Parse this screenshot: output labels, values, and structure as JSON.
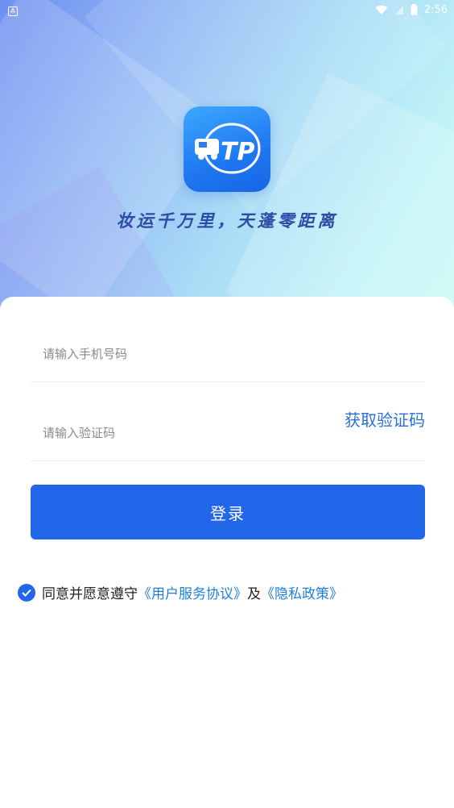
{
  "status_bar": {
    "app_badge": "A",
    "time": "2:56"
  },
  "logo": {
    "monogram": "TP"
  },
  "slogan": "妆运千万里，天蓬零距离",
  "form": {
    "phone_placeholder": "请输入手机号码",
    "code_placeholder": "请输入验证码",
    "get_code_label": "获取验证码",
    "login_label": "登录"
  },
  "agreement": {
    "checked": true,
    "prefix": "同意并愿意遵守",
    "user_agreement": "《用户服务协议》",
    "conjunction": "及",
    "privacy_policy": "《隐私政策》"
  },
  "colors": {
    "primary": "#2266ea",
    "link": "#1e7fd6"
  }
}
